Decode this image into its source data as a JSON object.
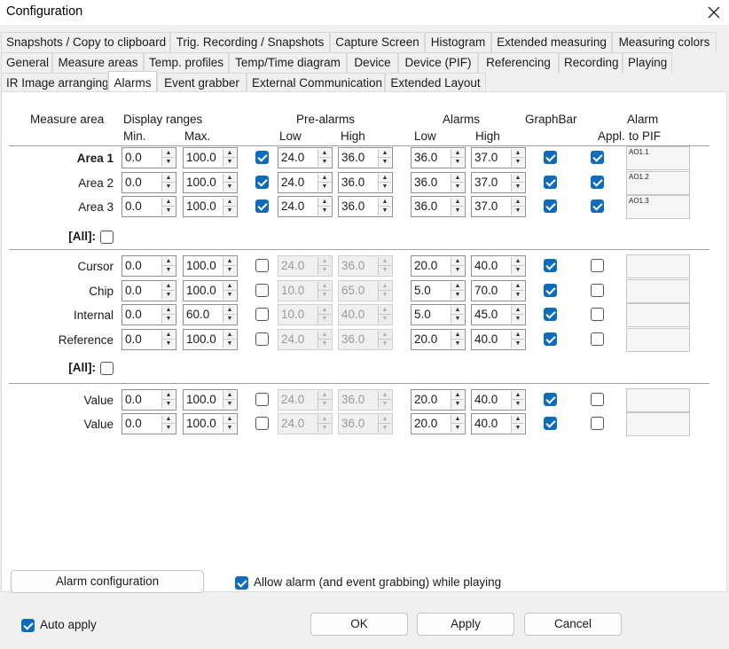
{
  "window": {
    "title": "Configuration"
  },
  "tabs": {
    "row1": [
      "Snapshots / Copy to clipboard",
      "Trig. Recording / Snapshots",
      "Capture Screen",
      "Histogram",
      "Extended measuring",
      "Measuring colors"
    ],
    "row2": [
      "General",
      "Measure areas",
      "Temp. profiles",
      "Temp/Time diagram",
      "Device",
      "Device (PIF)",
      "Referencing",
      "Recording",
      "Playing"
    ],
    "row3": [
      "IR Image arranging",
      "Alarms",
      "Event grabber",
      "External Communication",
      "Extended Layout"
    ],
    "active": "Alarms"
  },
  "headers": {
    "measure_area": "Measure area",
    "display_ranges": "Display ranges",
    "min": "Min.",
    "max": "Max.",
    "pre_alarms": "Pre-alarms",
    "pre_low": "Low",
    "pre_high": "High",
    "alarms": "Alarms",
    "al_low": "Low",
    "al_high": "High",
    "graphbar": "GraphBar",
    "appl": "Appl.",
    "alarm_to_pif_1": "Alarm",
    "alarm_to_pif_2": "to PIF"
  },
  "groups": [
    {
      "rows": [
        {
          "label": "Area 1",
          "bold": true,
          "min": "0.0",
          "max": "100.0",
          "pre_on": true,
          "pre_low": "24.0",
          "pre_high": "36.0",
          "al_low": "36.0",
          "al_high": "37.0",
          "graphbar": true,
          "appl": true,
          "pif": "AO1.1"
        },
        {
          "label": "Area 2",
          "bold": false,
          "min": "0.0",
          "max": "100.0",
          "pre_on": true,
          "pre_low": "24.0",
          "pre_high": "36.0",
          "al_low": "36.0",
          "al_high": "37.0",
          "graphbar": true,
          "appl": true,
          "pif": "AO1.2"
        },
        {
          "label": "Area 3",
          "bold": false,
          "min": "0.0",
          "max": "100.0",
          "pre_on": true,
          "pre_low": "24.0",
          "pre_high": "36.0",
          "al_low": "36.0",
          "al_high": "37.0",
          "graphbar": true,
          "appl": true,
          "pif": "AO1.3"
        }
      ],
      "all_label": "[All]:",
      "all_checked": false
    },
    {
      "rows": [
        {
          "label": "Cursor",
          "bold": false,
          "min": "0.0",
          "max": "100.0",
          "pre_on": false,
          "pre_low": "24.0",
          "pre_high": "36.0",
          "al_low": "20.0",
          "al_high": "40.0",
          "graphbar": true,
          "appl": false,
          "pif": ""
        },
        {
          "label": "Chip",
          "bold": false,
          "min": "0.0",
          "max": "100.0",
          "pre_on": false,
          "pre_low": "10.0",
          "pre_high": "65.0",
          "al_low": "5.0",
          "al_high": "70.0",
          "graphbar": true,
          "appl": false,
          "pif": ""
        },
        {
          "label": "Internal",
          "bold": false,
          "min": "0.0",
          "max": "60.0",
          "pre_on": false,
          "pre_low": "10.0",
          "pre_high": "40.0",
          "al_low": "5.0",
          "al_high": "45.0",
          "graphbar": true,
          "appl": false,
          "pif": ""
        },
        {
          "label": "Reference",
          "bold": false,
          "min": "0.0",
          "max": "100.0",
          "pre_on": false,
          "pre_low": "24.0",
          "pre_high": "36.0",
          "al_low": "20.0",
          "al_high": "40.0",
          "graphbar": true,
          "appl": false,
          "pif": ""
        }
      ],
      "all_label": "[All]:",
      "all_checked": false
    },
    {
      "rows": [
        {
          "label": "Value",
          "bold": false,
          "min": "0.0",
          "max": "100.0",
          "pre_on": false,
          "pre_low": "24.0",
          "pre_high": "36.0",
          "al_low": "20.0",
          "al_high": "40.0",
          "graphbar": true,
          "appl": false,
          "pif": ""
        },
        {
          "label": "Value",
          "bold": false,
          "min": "0.0",
          "max": "100.0",
          "pre_on": false,
          "pre_low": "24.0",
          "pre_high": "36.0",
          "al_low": "20.0",
          "al_high": "40.0",
          "graphbar": true,
          "appl": false,
          "pif": ""
        }
      ]
    }
  ],
  "buttons": {
    "alarm_config": "Alarm configuration",
    "ok": "OK",
    "apply": "Apply",
    "cancel": "Cancel"
  },
  "options": {
    "allow_alarm_label": "Allow alarm (and event grabbing) while playing",
    "allow_alarm_checked": true,
    "auto_apply_label": "Auto apply",
    "auto_apply_checked": true
  },
  "colors": {
    "accent": "#0f6cbd",
    "panel": "#ffffff",
    "window": "#f0f0f0"
  }
}
